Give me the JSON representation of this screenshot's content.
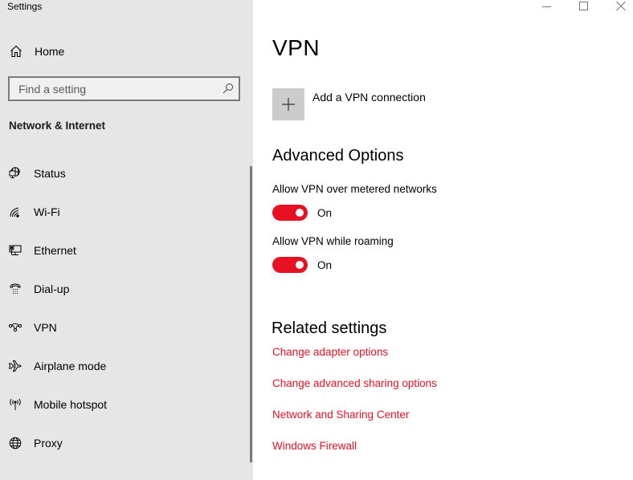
{
  "window": {
    "title": "Settings",
    "controls": [
      {
        "name": "minimize",
        "icon": "minimize-icon"
      },
      {
        "name": "maximize",
        "icon": "maximize-icon"
      },
      {
        "name": "close",
        "icon": "close-icon"
      }
    ]
  },
  "sidebar": {
    "home": {
      "label": "Home",
      "icon": "home-icon"
    },
    "search": {
      "placeholder": "Find a setting",
      "value": "",
      "icon": "search-icon"
    },
    "section_title": "Network & Internet",
    "items": [
      {
        "label": "Status",
        "icon": "status-globe-monitor-icon"
      },
      {
        "label": "Wi-Fi",
        "icon": "wifi-icon"
      },
      {
        "label": "Ethernet",
        "icon": "ethernet-icon"
      },
      {
        "label": "Dial-up",
        "icon": "dialup-phone-icon"
      },
      {
        "label": "VPN",
        "icon": "vpn-icon",
        "selected": true
      },
      {
        "label": "Airplane mode",
        "icon": "airplane-icon"
      },
      {
        "label": "Mobile hotspot",
        "icon": "hotspot-icon"
      },
      {
        "label": "Proxy",
        "icon": "globe-icon"
      }
    ]
  },
  "main": {
    "title": "VPN",
    "add_connection": {
      "label": "Add a VPN connection",
      "icon": "plus-icon"
    },
    "advanced": {
      "heading": "Advanced Options",
      "options": [
        {
          "label": "Allow VPN over metered networks",
          "state": "On",
          "enabled": true
        },
        {
          "label": "Allow VPN while roaming",
          "state": "On",
          "enabled": true
        }
      ]
    },
    "related": {
      "heading": "Related settings",
      "links": [
        "Change adapter options",
        "Change advanced sharing options",
        "Network and Sharing Center",
        "Windows Firewall"
      ]
    }
  },
  "colors": {
    "accent": "#e81123",
    "sidebar_bg": "#e6e6e6",
    "add_button_bg": "#cccccc"
  }
}
